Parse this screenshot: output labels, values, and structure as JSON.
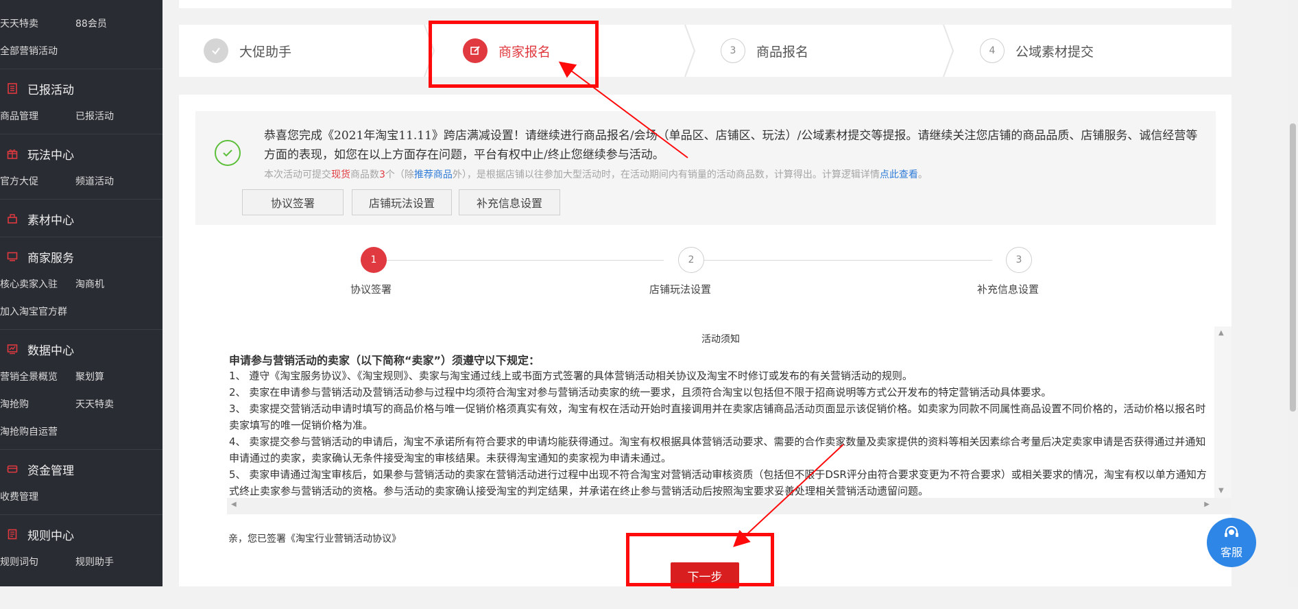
{
  "sidebar": {
    "groups": [
      {
        "title": "",
        "icon": "",
        "rows": [
          [
            "天天特卖",
            "88会员"
          ],
          [
            "全部营销活动",
            ""
          ]
        ]
      },
      {
        "title": "已报活动",
        "icon": "list-icon",
        "rows": [
          [
            "商品管理",
            "已报活动"
          ]
        ]
      },
      {
        "title": "玩法中心",
        "icon": "gift-icon",
        "rows": [
          [
            "官方大促",
            "频道活动"
          ]
        ]
      },
      {
        "title": "素材中心",
        "icon": "material-icon",
        "rows": []
      },
      {
        "title": "商家服务",
        "icon": "monitor-icon",
        "rows": [
          [
            "核心卖家入驻",
            "淘商机"
          ],
          [
            "加入淘宝官方群",
            ""
          ]
        ]
      },
      {
        "title": "数据中心",
        "icon": "chart-icon",
        "rows": [
          [
            "营销全景概览",
            "聚划算"
          ],
          [
            "淘抢购",
            "天天特卖"
          ],
          [
            "淘抢购自运营",
            ""
          ]
        ]
      },
      {
        "title": "资金管理",
        "icon": "card-icon",
        "rows": [
          [
            "收费管理",
            ""
          ]
        ]
      },
      {
        "title": "规则中心",
        "icon": "doc-icon",
        "rows": [
          [
            "规则词句",
            "规则助手"
          ]
        ]
      }
    ]
  },
  "steps": [
    {
      "num": "",
      "label": "大促助手",
      "state": "done"
    },
    {
      "num": "",
      "label": "商家报名",
      "state": "active"
    },
    {
      "num": "3",
      "label": "商品报名",
      "state": "todo"
    },
    {
      "num": "4",
      "label": "公域素材提交",
      "state": "todo"
    }
  ],
  "notice": {
    "message": "恭喜您完成《2021年淘宝11.11》跨店满减设置！请继续进行商品报名/会场（单品区、店铺区、玩法）/公域素材提交等提报。请继续关注您店铺的商品品质、店铺服务、诚信经营等方面的表现，如您在以上方面存在问题，平台有权中止/终止您继续参与活动。",
    "sub_a": "本次活动可提交",
    "sub_red1": "现货",
    "sub_b": "商品数",
    "sub_red2": "3",
    "sub_c": "个（除",
    "sub_blue1": "推荐商品",
    "sub_d": "外），是根据店铺以往参加大型活动时，在活动期间内有销量的活动商品数，计算得出。计算逻辑详情",
    "sub_blue2": "点此查看",
    "sub_e": "。",
    "buttons": [
      "协议签署",
      "店铺玩法设置",
      "补充信息设置"
    ]
  },
  "progress": [
    {
      "num": "1",
      "label": "协议签署",
      "state": "active"
    },
    {
      "num": "2",
      "label": "店铺玩法设置",
      "state": "todo"
    },
    {
      "num": "3",
      "label": "补充信息设置",
      "state": "todo"
    }
  ],
  "rules": {
    "title": "活动须知",
    "heading": "申请参与营销活动的卖家（以下简称“卖家”）须遵守以下规定：",
    "items": [
      "1、 遵守《淘宝服务协议》、《淘宝规则》、卖家与淘宝通过线上或书面方式签署的具体营销活动相关协议及淘宝不时修订或发布的有关营销活动的规则。",
      "2、 卖家在申请参与营销活动及营销活动参与过程中均须符合淘宝对参与营销活动卖家的统一要求，且须符合淘宝以包括但不限于招商说明等方式公开发布的特定营销活动具体要求。",
      "3、 卖家提交营销活动申请时填写的商品价格与唯一促销价格须真实有效，淘宝有权在活动开始时直接调用并在卖家店铺商品活动页面显示该促销价格。如卖家为同款不同属性商品设置不同价格的，活动价格以报名时卖家填写的唯一促销价格为准。",
      "4、 卖家提交参与营销活动的申请后，淘宝不承诺所有符合要求的申请均能获得通过。淘宝有权根据具体营销活动要求、需要的合作卖家数量及卖家提供的资料等相关因素综合考量后决定卖家申请是否获得通过并通知申请通过的卖家，卖家确认无条件接受淘宝的审核结果。未获得淘宝通知的卖家视为申请未通过。",
      "5、 卖家申请通过淘宝审核后，如果参与营销活动的卖家在营销活动进行过程中出现不符合淘宝对营销活动审核资质（包括但不限于DSR评分由符合要求变更为不符合要求）或相关要求的情况，淘宝有权以单方通知方式终止卖家参与营销活动的资格。参与活动的卖家确认接受淘宝的判定结果，并承诺在终止参与营销活动后按照淘宝要求妥善处理相关营销活动遗留问题。"
    ]
  },
  "signed_text": "亲，您已签署《淘宝行业营销活动协议》",
  "next_label": "下一步",
  "service_label": "客服",
  "colors": {
    "accent": "#e0393f",
    "link": "#2f7bd8",
    "annotation": "#ff0a0a"
  }
}
